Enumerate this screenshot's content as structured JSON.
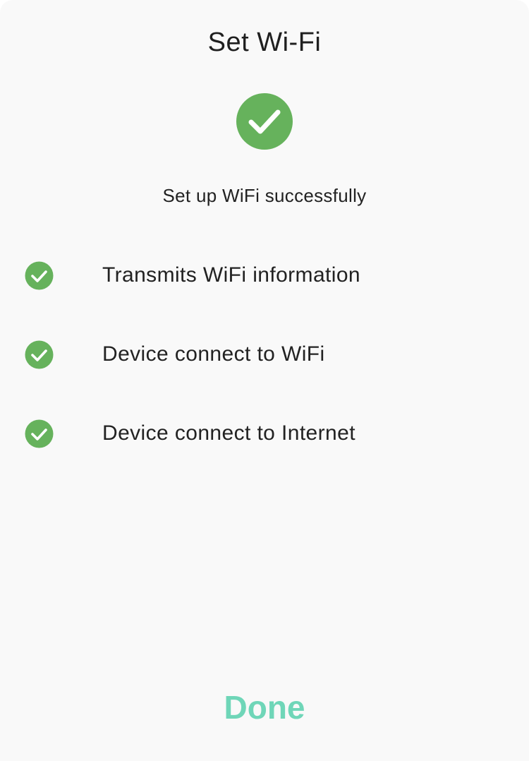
{
  "sheet": {
    "title": "Set Wi-Fi",
    "status_icon": "checkmark-circle-icon",
    "subtitle": "Set up WiFi successfully"
  },
  "steps": [
    {
      "label": "Transmits WiFi information",
      "icon": "checkmark-circle-icon",
      "status": "done"
    },
    {
      "label": "Device connect to WiFi",
      "icon": "checkmark-circle-icon",
      "status": "done"
    },
    {
      "label": "Device connect to Internet",
      "icon": "checkmark-circle-icon",
      "status": "done"
    }
  ],
  "actions": {
    "done_label": "Done"
  },
  "colors": {
    "success_green": "#66b25c",
    "accent_teal": "#6fd6b8",
    "background": "#f9f9f9",
    "text": "#222222"
  }
}
